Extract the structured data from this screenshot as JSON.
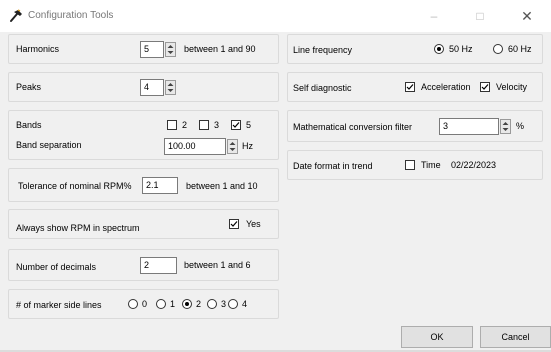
{
  "window": {
    "title": "Configuration Tools",
    "minimize": "–",
    "maximize": "□",
    "close": "✕"
  },
  "harmonics": {
    "label": "Harmonics",
    "value": "5",
    "hint": "between 1 and 90"
  },
  "peaks": {
    "label": "Peaks",
    "value": "4"
  },
  "bands": {
    "label": "Bands",
    "options": [
      "2",
      "3",
      "5"
    ],
    "checked": [
      false,
      false,
      true
    ],
    "separation_label": "Band separation",
    "separation_value": "100.00",
    "unit": "Hz"
  },
  "tolerance": {
    "label": "Tolerance of nominal RPM%",
    "value": "2.1",
    "hint": "between 1 and 10"
  },
  "rpm_spectrum": {
    "label": "Always show RPM in spectrum",
    "option": "Yes",
    "checked": true
  },
  "decimals": {
    "label": "Number of decimals",
    "value": "2",
    "hint": "between 1 and 6"
  },
  "marker_lines": {
    "label": "# of marker side lines",
    "options": [
      "0",
      "1",
      "2",
      "3",
      "4"
    ],
    "selected": "2"
  },
  "line_frequency": {
    "label": "Line frequency",
    "options": [
      "50 Hz",
      "60 Hz"
    ],
    "selected": "50 Hz"
  },
  "self_diagnostic": {
    "label": "Self diagnostic",
    "options": [
      "Acceleration",
      "Velocity"
    ],
    "checked": [
      true,
      true
    ]
  },
  "conversion_filter": {
    "label": "Mathematical conversion filter",
    "value": "3",
    "unit": "%"
  },
  "date_format": {
    "label": "Date format in trend",
    "option": "Time",
    "checked": false,
    "date": "02/22/2023"
  },
  "buttons": {
    "ok": "OK",
    "cancel": "Cancel"
  }
}
